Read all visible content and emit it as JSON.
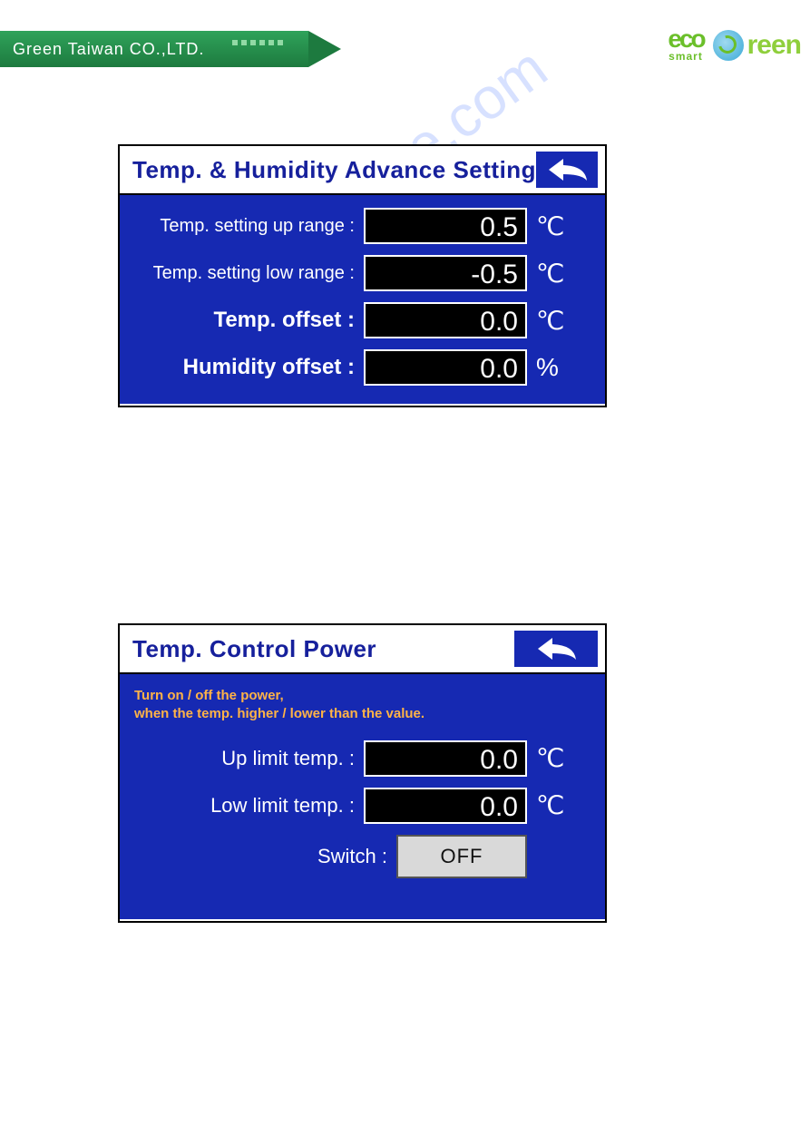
{
  "header": {
    "company": "Green Taiwan CO.,LTD.",
    "eco_top": "eco",
    "eco_bottom": "smart",
    "green_text": "reen"
  },
  "watermark": "manualshive.com",
  "panel1": {
    "title": "Temp. & Humidity Advance Setting",
    "rows": [
      {
        "label": "Temp. setting up range :",
        "value": "0.5",
        "unit": "℃"
      },
      {
        "label": "Temp. setting low range :",
        "value": "-0.5",
        "unit": "℃"
      },
      {
        "label": "Temp. offset :",
        "value": "0.0",
        "unit": "℃",
        "big": true
      },
      {
        "label": "Humidity offset :",
        "value": "0.0",
        "unit": "%",
        "big": true
      }
    ]
  },
  "panel2": {
    "title": "Temp. Control Power",
    "hint_line1": "Turn on / off the power,",
    "hint_line2": "when the temp. higher / lower than the value.",
    "rows": [
      {
        "label": "Up limit temp. :",
        "value": "0.0",
        "unit": "℃"
      },
      {
        "label": "Low limit temp. :",
        "value": "0.0",
        "unit": "℃"
      }
    ],
    "switch_label": "Switch :",
    "switch_value": "OFF"
  }
}
